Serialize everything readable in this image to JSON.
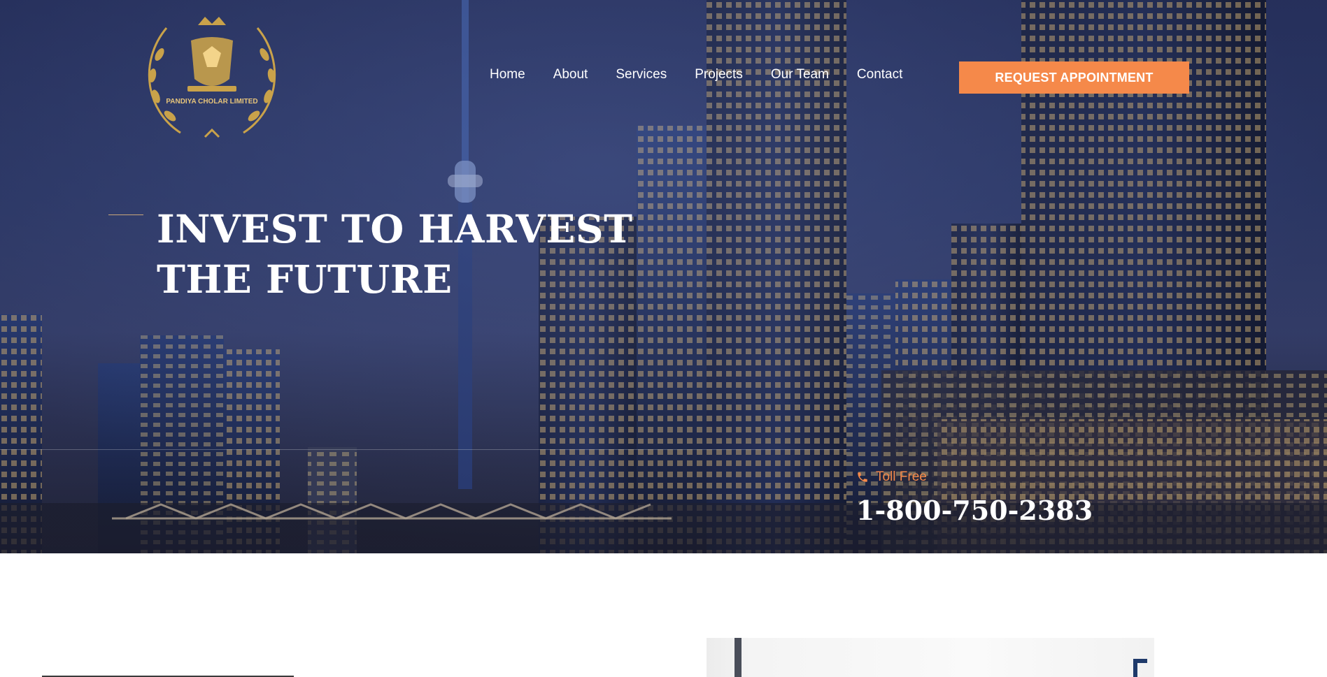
{
  "header": {
    "logo_text": "PANDIYA CHOLAR LIMITED",
    "nav": [
      {
        "label": "Home"
      },
      {
        "label": "About"
      },
      {
        "label": "Services"
      },
      {
        "label": "Projects"
      },
      {
        "label": "Our Team"
      },
      {
        "label": "Contact"
      }
    ],
    "cta_label": "REQUEST APPOINTMENT"
  },
  "hero": {
    "headline_line1": "INVEST TO HARVEST",
    "headline_line2": "THE FUTURE",
    "toll_free_label": "Toll Free",
    "phone": "1-800-750-2383",
    "icon": "phone-icon"
  },
  "colors": {
    "accent": "#f5894a",
    "hero_bg": "#2f3a6a",
    "text": "#ffffff"
  }
}
